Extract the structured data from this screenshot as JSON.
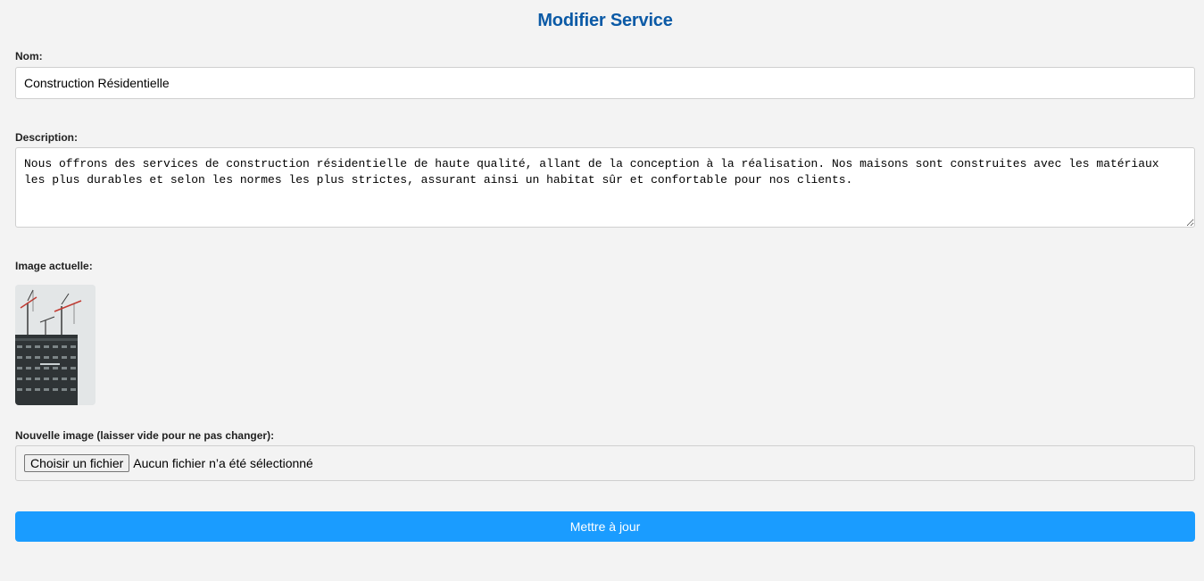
{
  "form": {
    "title": "Modifier Service",
    "name_label": "Nom:",
    "name_value": "Construction Résidentielle",
    "description_label": "Description:",
    "description_value": "Nous offrons des services de construction résidentielle de haute qualité, allant de la conception à la réalisation. Nos maisons sont construites avec les matériaux les plus durables et selon les normes les plus strictes, assurant ainsi un habitat sûr et confortable pour nos clients.",
    "current_image_label": "Image actuelle:",
    "current_image_icon": "construction-crane-photo",
    "new_image_label": "Nouvelle image (laisser vide pour ne pas changer):",
    "file_button_label": "Choisir un fichier",
    "file_status": "Aucun fichier n’a été sélectionné",
    "submit_label": "Mettre à jour"
  },
  "colors": {
    "title": "#0b5aa6",
    "primary_button": "#1a9cff",
    "background": "#f3f3f3"
  }
}
